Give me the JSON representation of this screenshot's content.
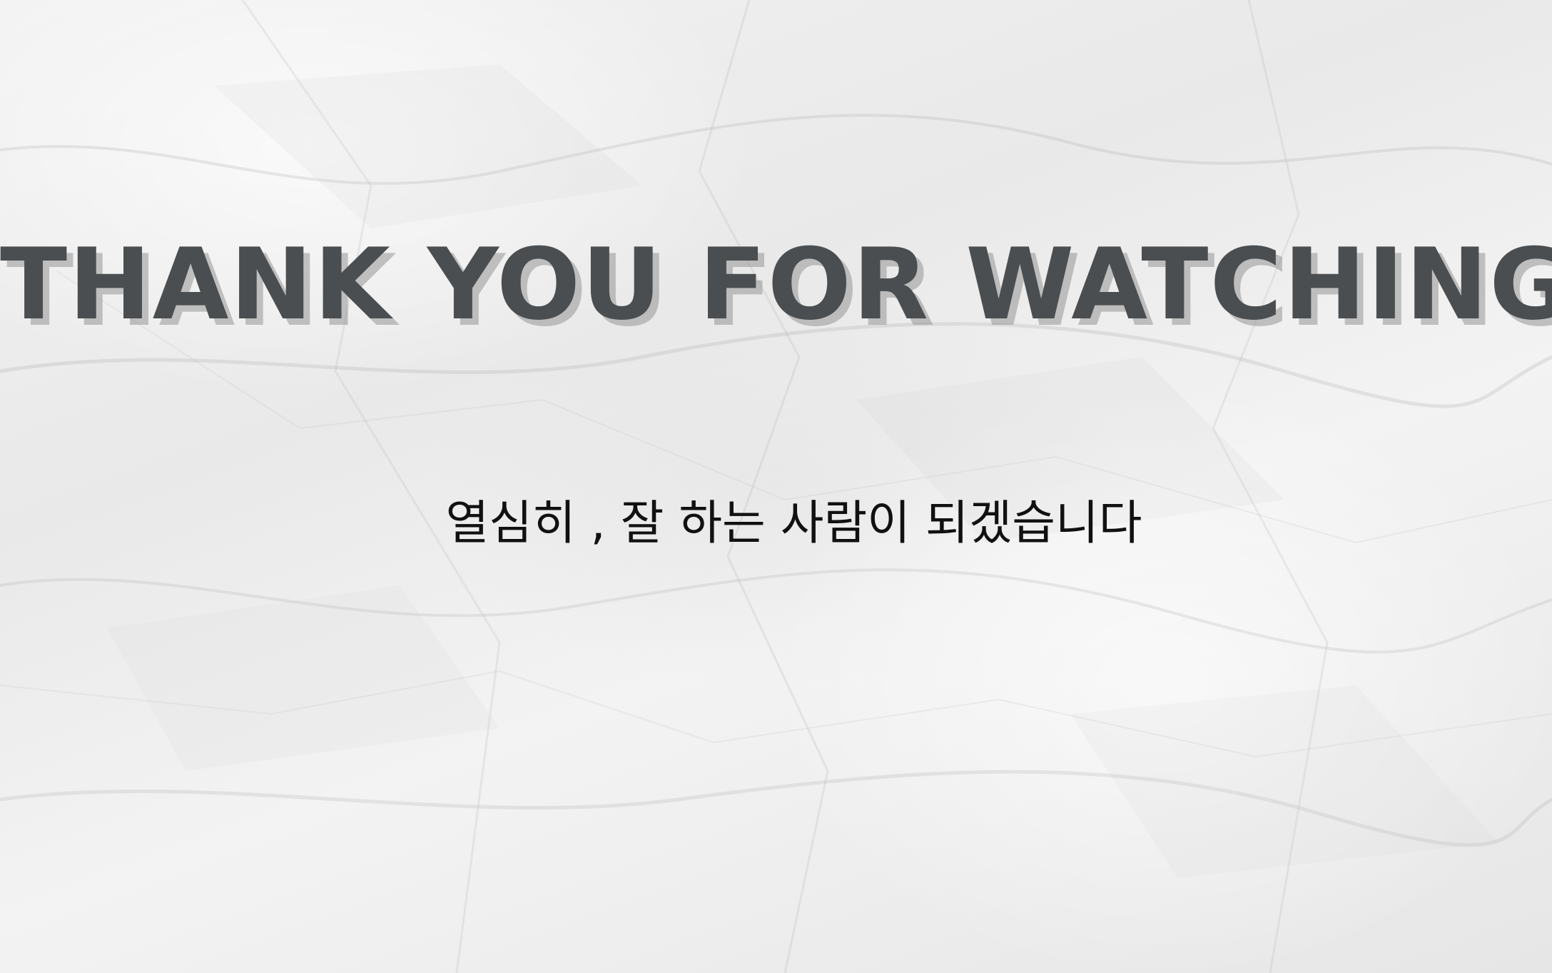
{
  "slide": {
    "title": "THANK YOU FOR WATCHING",
    "subtitle": "열심히 , 잘 하는 사람이 되겠습니다"
  },
  "colors": {
    "background": "#eeeeee",
    "title_text": "#4b4e50",
    "title_shadow": "#969696",
    "subtitle_text": "#111111"
  }
}
